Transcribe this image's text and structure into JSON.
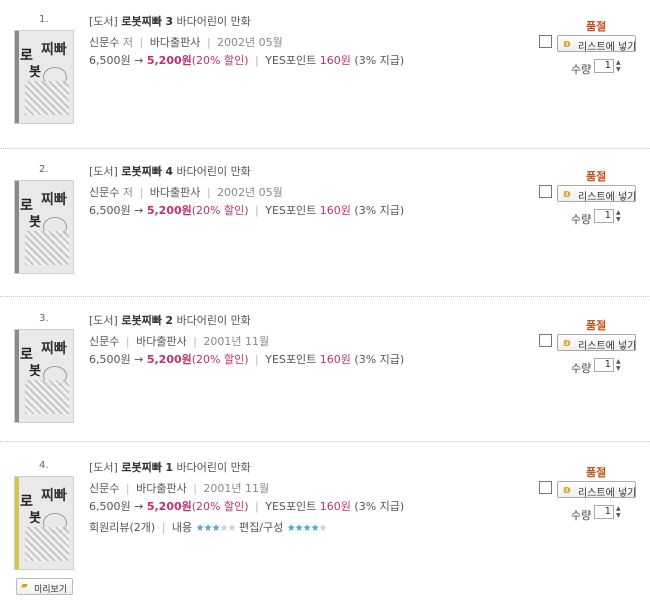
{
  "items": [
    {
      "number": "1.",
      "category": "[도서]",
      "title": "로봇찌빠",
      "volume": "3",
      "publisher_series": "바다어린이 만화",
      "author": "신문수",
      "author_role": "저",
      "publisher": "바다출판사",
      "date": "2002년 05월",
      "list_price": "6,500원",
      "arrow": "→",
      "sale_price": "5,200원",
      "discount": "(20% 할인)",
      "points_label": "YES포인트",
      "points": "160원",
      "points_rate": "(3% 지급)",
      "status": "품절",
      "list_button": "리스트에 넣기",
      "qty_label": "수량",
      "qty": "1"
    },
    {
      "number": "2.",
      "category": "[도서]",
      "title": "로봇찌빠",
      "volume": "4",
      "publisher_series": "바다어린이 만화",
      "author": "신문수",
      "author_role": "저",
      "publisher": "바다출판사",
      "date": "2002년 05월",
      "list_price": "6,500원",
      "arrow": "→",
      "sale_price": "5,200원",
      "discount": "(20% 할인)",
      "points_label": "YES포인트",
      "points": "160원",
      "points_rate": "(3% 지급)",
      "status": "품절",
      "list_button": "리스트에 넣기",
      "qty_label": "수량",
      "qty": "1"
    },
    {
      "number": "3.",
      "category": "[도서]",
      "title": "로봇찌빠",
      "volume": "2",
      "publisher_series": "바다어린이 만화",
      "author": "신문수",
      "author_role": "",
      "publisher": "바다출판사",
      "date": "2001년 11월",
      "list_price": "6,500원",
      "arrow": "→",
      "sale_price": "5,200원",
      "discount": "(20% 할인)",
      "points_label": "YES포인트",
      "points": "160원",
      "points_rate": "(3% 지급)",
      "status": "품절",
      "list_button": "리스트에 넣기",
      "qty_label": "수량",
      "qty": "1"
    },
    {
      "number": "4.",
      "category": "[도서]",
      "title": "로봇찌빠",
      "volume": "1",
      "publisher_series": "바다어린이 만화",
      "author": "신문수",
      "author_role": "",
      "publisher": "바다출판사",
      "date": "2001년 11월",
      "list_price": "6,500원",
      "arrow": "→",
      "sale_price": "5,200원",
      "discount": "(20% 할인)",
      "points_label": "YES포인트",
      "points": "160원",
      "points_rate": "(3% 지급)",
      "review_label": "회원리뷰",
      "review_count": "(2개)",
      "rating_content_label": "내용",
      "rating_content": 3,
      "rating_edit_label": "편집/구성",
      "rating_edit": 4,
      "status": "품절",
      "list_button": "리스트에 넣기",
      "qty_label": "수량",
      "qty": "1",
      "preview_button": "미리보기"
    }
  ],
  "colors": {
    "accent": "#c0306b",
    "status": "#c0521d",
    "stars": "#49a6c9"
  },
  "icons": {
    "list_button_icon": "basket-icon",
    "preview_icon": "book-icon",
    "spinner": "up-down-arrow-icon"
  }
}
